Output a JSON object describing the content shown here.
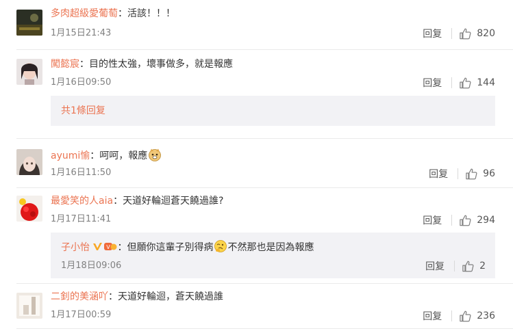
{
  "comments": [
    {
      "user": "多肉超級愛葡萄",
      "text": "活該！！！",
      "time": "1月15日21:43",
      "reply": "回复",
      "likes": "820"
    },
    {
      "user": "闖懿宸",
      "text": "目的性太強，壞事做多，就是報應",
      "time": "1月16日09:50",
      "reply": "回复",
      "likes": "144",
      "more_replies": "共1條回复"
    },
    {
      "user": "ayumi愉",
      "text": "呵呵，報應",
      "time": "1月16日11:50",
      "reply": "回复",
      "likes": "96",
      "emoji": "doge-emoji"
    },
    {
      "user": "最愛笑的人aia",
      "text": "天道好輪迴蒼天饒過誰?",
      "time": "1月17日11:41",
      "reply": "回复",
      "likes": "294",
      "sub_reply": {
        "user": "子小怡",
        "text_a": "但願你這輩子別得病",
        "text_b": "不然那也是因為報應",
        "time": "1月18日09:06",
        "reply": "回复",
        "likes": "2"
      }
    },
    {
      "user": "二釗的美涵吖",
      "text": "天道好輪迴，蒼天饒過誰",
      "time": "1月17日00:59",
      "reply": "回复",
      "likes": "236"
    }
  ],
  "colon": "：",
  "colors": {
    "username": "#eb7350",
    "text": "#333333",
    "meta": "#808080",
    "reply_bg": "#f2f2f5"
  }
}
